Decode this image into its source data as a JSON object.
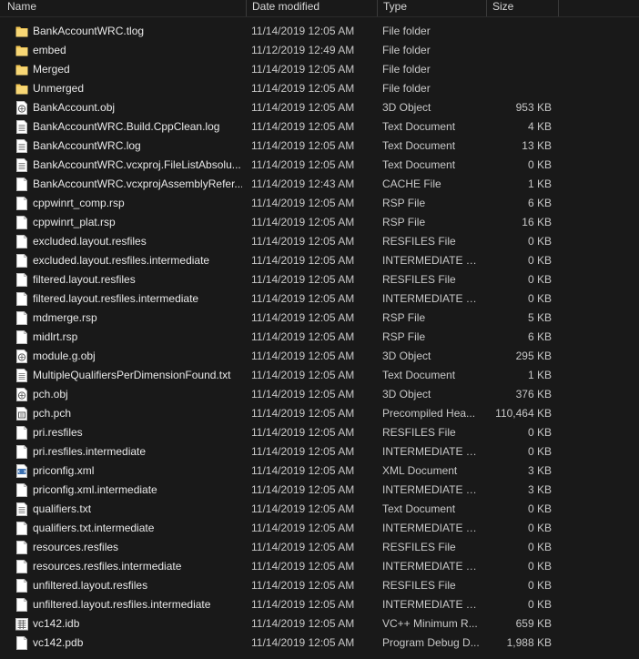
{
  "colors": {
    "background": "#191919",
    "folder": "#f3c755",
    "text": "#e6e6e6"
  },
  "header": {
    "name": "Name",
    "date": "Date modified",
    "type": "Type",
    "size": "Size"
  },
  "files": [
    {
      "name": "BankAccountWRC.tlog",
      "date": "11/14/2019 12:05 AM",
      "type": "File folder",
      "size": "",
      "icon": "folder-icon"
    },
    {
      "name": "embed",
      "date": "11/12/2019 12:49 AM",
      "type": "File folder",
      "size": "",
      "icon": "folder-icon"
    },
    {
      "name": "Merged",
      "date": "11/14/2019 12:05 AM",
      "type": "File folder",
      "size": "",
      "icon": "folder-icon"
    },
    {
      "name": "Unmerged",
      "date": "11/14/2019 12:05 AM",
      "type": "File folder",
      "size": "",
      "icon": "folder-icon"
    },
    {
      "name": "BankAccount.obj",
      "date": "11/14/2019 12:05 AM",
      "type": "3D Object",
      "size": "953 KB",
      "icon": "3d-object-icon"
    },
    {
      "name": "BankAccountWRC.Build.CppClean.log",
      "date": "11/14/2019 12:05 AM",
      "type": "Text Document",
      "size": "4 KB",
      "icon": "text-document-icon"
    },
    {
      "name": "BankAccountWRC.log",
      "date": "11/14/2019 12:05 AM",
      "type": "Text Document",
      "size": "13 KB",
      "icon": "text-document-icon"
    },
    {
      "name": "BankAccountWRC.vcxproj.FileListAbsolu...",
      "date": "11/14/2019 12:05 AM",
      "type": "Text Document",
      "size": "0 KB",
      "icon": "text-document-icon"
    },
    {
      "name": "BankAccountWRC.vcxprojAssemblyRefer...",
      "date": "11/14/2019 12:43 AM",
      "type": "CACHE File",
      "size": "1 KB",
      "icon": "file-icon"
    },
    {
      "name": "cppwinrt_comp.rsp",
      "date": "11/14/2019 12:05 AM",
      "type": "RSP File",
      "size": "6 KB",
      "icon": "file-icon"
    },
    {
      "name": "cppwinrt_plat.rsp",
      "date": "11/14/2019 12:05 AM",
      "type": "RSP File",
      "size": "16 KB",
      "icon": "file-icon"
    },
    {
      "name": "excluded.layout.resfiles",
      "date": "11/14/2019 12:05 AM",
      "type": "RESFILES File",
      "size": "0 KB",
      "icon": "file-icon"
    },
    {
      "name": "excluded.layout.resfiles.intermediate",
      "date": "11/14/2019 12:05 AM",
      "type": "INTERMEDIATE File",
      "size": "0 KB",
      "icon": "file-icon"
    },
    {
      "name": "filtered.layout.resfiles",
      "date": "11/14/2019 12:05 AM",
      "type": "RESFILES File",
      "size": "0 KB",
      "icon": "file-icon"
    },
    {
      "name": "filtered.layout.resfiles.intermediate",
      "date": "11/14/2019 12:05 AM",
      "type": "INTERMEDIATE File",
      "size": "0 KB",
      "icon": "file-icon"
    },
    {
      "name": "mdmerge.rsp",
      "date": "11/14/2019 12:05 AM",
      "type": "RSP File",
      "size": "5 KB",
      "icon": "file-icon"
    },
    {
      "name": "midlrt.rsp",
      "date": "11/14/2019 12:05 AM",
      "type": "RSP File",
      "size": "6 KB",
      "icon": "file-icon"
    },
    {
      "name": "module.g.obj",
      "date": "11/14/2019 12:05 AM",
      "type": "3D Object",
      "size": "295 KB",
      "icon": "3d-object-icon"
    },
    {
      "name": "MultipleQualifiersPerDimensionFound.txt",
      "date": "11/14/2019 12:05 AM",
      "type": "Text Document",
      "size": "1 KB",
      "icon": "text-document-icon"
    },
    {
      "name": "pch.obj",
      "date": "11/14/2019 12:05 AM",
      "type": "3D Object",
      "size": "376 KB",
      "icon": "3d-object-icon"
    },
    {
      "name": "pch.pch",
      "date": "11/14/2019 12:05 AM",
      "type": "Precompiled Hea...",
      "size": "110,464 KB",
      "icon": "precompiled-header-icon"
    },
    {
      "name": "pri.resfiles",
      "date": "11/14/2019 12:05 AM",
      "type": "RESFILES File",
      "size": "0 KB",
      "icon": "file-icon"
    },
    {
      "name": "pri.resfiles.intermediate",
      "date": "11/14/2019 12:05 AM",
      "type": "INTERMEDIATE File",
      "size": "0 KB",
      "icon": "file-icon"
    },
    {
      "name": "priconfig.xml",
      "date": "11/14/2019 12:05 AM",
      "type": "XML Document",
      "size": "3 KB",
      "icon": "xml-document-icon"
    },
    {
      "name": "priconfig.xml.intermediate",
      "date": "11/14/2019 12:05 AM",
      "type": "INTERMEDIATE File",
      "size": "3 KB",
      "icon": "file-icon"
    },
    {
      "name": "qualifiers.txt",
      "date": "11/14/2019 12:05 AM",
      "type": "Text Document",
      "size": "0 KB",
      "icon": "text-document-icon"
    },
    {
      "name": "qualifiers.txt.intermediate",
      "date": "11/14/2019 12:05 AM",
      "type": "INTERMEDIATE File",
      "size": "0 KB",
      "icon": "file-icon"
    },
    {
      "name": "resources.resfiles",
      "date": "11/14/2019 12:05 AM",
      "type": "RESFILES File",
      "size": "0 KB",
      "icon": "file-icon"
    },
    {
      "name": "resources.resfiles.intermediate",
      "date": "11/14/2019 12:05 AM",
      "type": "INTERMEDIATE File",
      "size": "0 KB",
      "icon": "file-icon"
    },
    {
      "name": "unfiltered.layout.resfiles",
      "date": "11/14/2019 12:05 AM",
      "type": "RESFILES File",
      "size": "0 KB",
      "icon": "file-icon"
    },
    {
      "name": "unfiltered.layout.resfiles.intermediate",
      "date": "11/14/2019 12:05 AM",
      "type": "INTERMEDIATE File",
      "size": "0 KB",
      "icon": "file-icon"
    },
    {
      "name": "vc142.idb",
      "date": "11/14/2019 12:05 AM",
      "type": "VC++ Minimum R...",
      "size": "659 KB",
      "icon": "database-icon"
    },
    {
      "name": "vc142.pdb",
      "date": "11/14/2019 12:05 AM",
      "type": "Program Debug D...",
      "size": "1,988 KB",
      "icon": "file-icon"
    }
  ]
}
